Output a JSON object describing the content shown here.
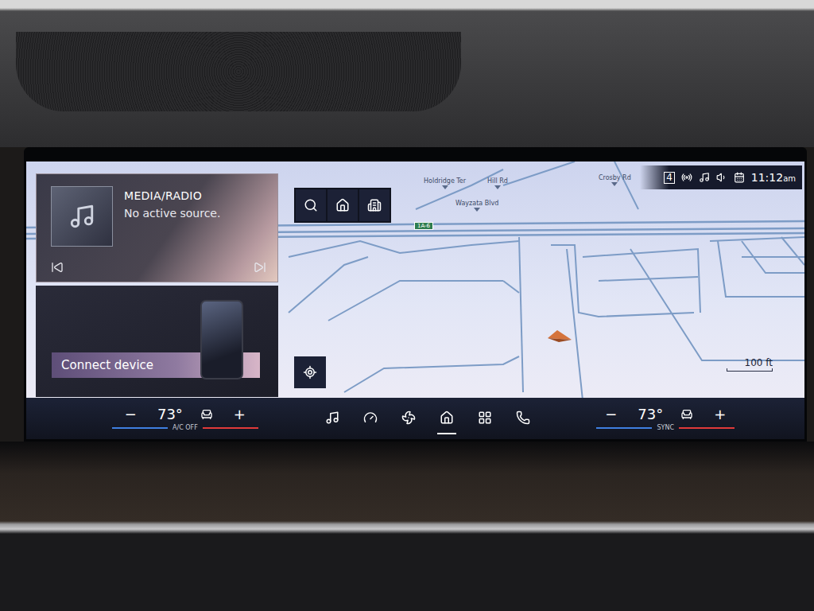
{
  "media": {
    "title": "MEDIA/RADIO",
    "status": "No active source."
  },
  "device": {
    "label": "Connect device"
  },
  "map": {
    "labels": [
      {
        "text": "Holdridge Ter"
      },
      {
        "text": "Hill Rd"
      },
      {
        "text": "Wayzata Blvd"
      },
      {
        "text": "Crosby Rd"
      }
    ],
    "highway_sign": "1A-6",
    "scale": "100 ft"
  },
  "status_bar": {
    "indicator": "4",
    "time": "11:12",
    "meridiem": "am"
  },
  "climate_left": {
    "minus": "−",
    "temp": "73°",
    "plus": "+",
    "mode": "A/C OFF"
  },
  "climate_right": {
    "minus": "−",
    "temp": "73°",
    "plus": "+",
    "mode": "SYNC"
  },
  "nav": [
    {
      "kind": "media",
      "selected": false
    },
    {
      "kind": "gauge",
      "selected": false
    },
    {
      "kind": "fan",
      "selected": false
    },
    {
      "kind": "home",
      "selected": true
    },
    {
      "kind": "apps",
      "selected": false
    },
    {
      "kind": "phone",
      "selected": false
    }
  ]
}
